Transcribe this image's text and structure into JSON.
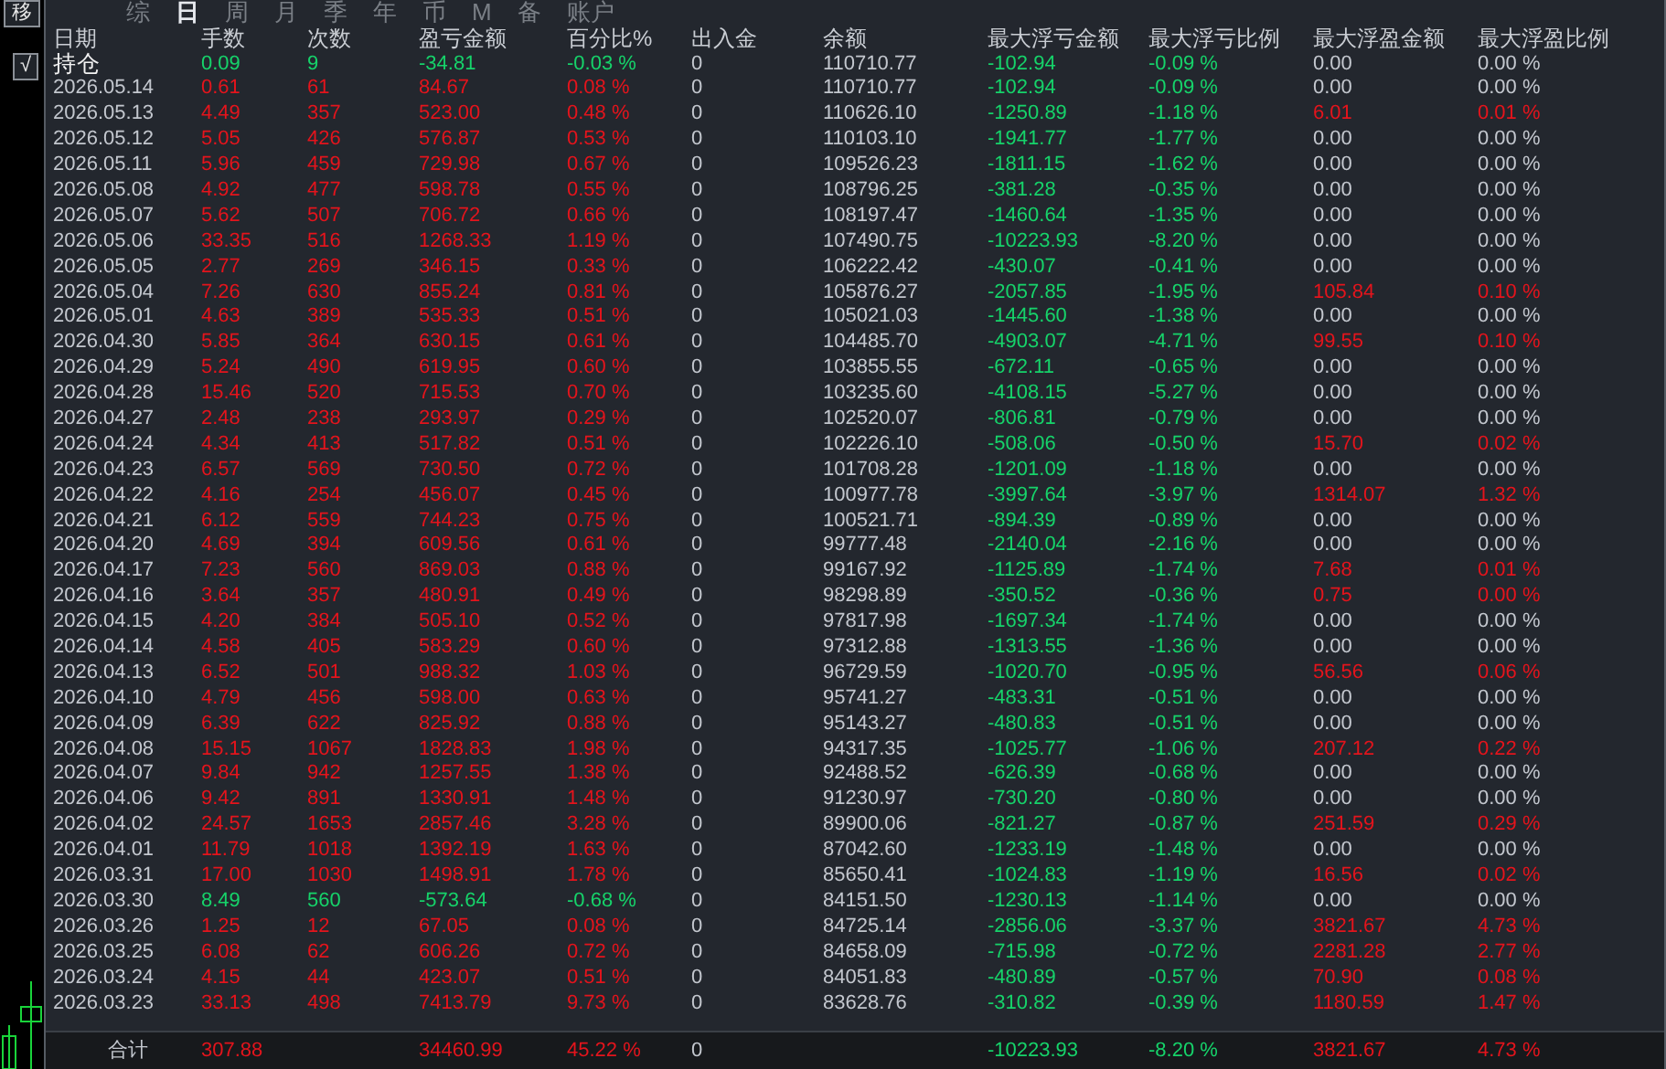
{
  "side_buttons": [
    "移",
    "√"
  ],
  "tabs": [
    {
      "label": "综",
      "selected": false
    },
    {
      "label": "日",
      "selected": true
    },
    {
      "label": "周",
      "selected": false
    },
    {
      "label": "月",
      "selected": false
    },
    {
      "label": "季",
      "selected": false
    },
    {
      "label": "年",
      "selected": false
    },
    {
      "label": "币",
      "selected": false
    },
    {
      "label": "M",
      "selected": false
    },
    {
      "label": "备",
      "selected": false
    },
    {
      "label": "账户",
      "selected": false
    }
  ],
  "table": {
    "columns": [
      "日期",
      "手数",
      "次数",
      "盈亏金额",
      "百分比%",
      "出入金",
      "余额",
      "最大浮亏金额",
      "最大浮亏比例",
      "最大浮盈金额",
      "最大浮盈比例"
    ],
    "rows": [
      {
        "kind": "position",
        "loss": true,
        "peak_gain": false,
        "cells": [
          "持仓",
          "0.09",
          "9",
          "-34.81",
          "-0.03 %",
          "0",
          "110710.77",
          "-102.94",
          "-0.09 %",
          "0.00",
          "0.00 %"
        ]
      },
      {
        "kind": "day",
        "loss": false,
        "peak_gain": false,
        "cells": [
          "2026.05.14",
          "0.61",
          "61",
          "84.67",
          "0.08 %",
          "0",
          "110710.77",
          "-102.94",
          "-0.09 %",
          "0.00",
          "0.00 %"
        ]
      },
      {
        "kind": "day",
        "loss": false,
        "peak_gain": true,
        "cells": [
          "2026.05.13",
          "4.49",
          "357",
          "523.00",
          "0.48 %",
          "0",
          "110626.10",
          "-1250.89",
          "-1.18 %",
          "6.01",
          "0.01 %"
        ]
      },
      {
        "kind": "day",
        "loss": false,
        "peak_gain": false,
        "cells": [
          "2026.05.12",
          "5.05",
          "426",
          "576.87",
          "0.53 %",
          "0",
          "110103.10",
          "-1941.77",
          "-1.77 %",
          "0.00",
          "0.00 %"
        ]
      },
      {
        "kind": "day",
        "loss": false,
        "peak_gain": false,
        "cells": [
          "2026.05.11",
          "5.96",
          "459",
          "729.98",
          "0.67 %",
          "0",
          "109526.23",
          "-1811.15",
          "-1.62 %",
          "0.00",
          "0.00 %"
        ]
      },
      {
        "kind": "day",
        "loss": false,
        "peak_gain": false,
        "cells": [
          "2026.05.08",
          "4.92",
          "477",
          "598.78",
          "0.55 %",
          "0",
          "108796.25",
          "-381.28",
          "-0.35 %",
          "0.00",
          "0.00 %"
        ]
      },
      {
        "kind": "day",
        "loss": false,
        "peak_gain": false,
        "cells": [
          "2026.05.07",
          "5.62",
          "507",
          "706.72",
          "0.66 %",
          "0",
          "108197.47",
          "-1460.64",
          "-1.35 %",
          "0.00",
          "0.00 %"
        ]
      },
      {
        "kind": "day",
        "loss": false,
        "peak_gain": false,
        "cells": [
          "2026.05.06",
          "33.35",
          "516",
          "1268.33",
          "1.19 %",
          "0",
          "107490.75",
          "-10223.93",
          "-8.20 %",
          "0.00",
          "0.00 %"
        ]
      },
      {
        "kind": "day",
        "loss": false,
        "peak_gain": false,
        "cells": [
          "2026.05.05",
          "2.77",
          "269",
          "346.15",
          "0.33 %",
          "0",
          "106222.42",
          "-430.07",
          "-0.41 %",
          "0.00",
          "0.00 %"
        ]
      },
      {
        "kind": "day",
        "loss": false,
        "peak_gain": true,
        "cells": [
          "2026.05.04",
          "7.26",
          "630",
          "855.24",
          "0.81 %",
          "0",
          "105876.27",
          "-2057.85",
          "-1.95 %",
          "105.84",
          "0.10 %"
        ]
      },
      {
        "kind": "day",
        "loss": false,
        "peak_gain": false,
        "cells": [
          "2026.05.01",
          "4.63",
          "389",
          "535.33",
          "0.51 %",
          "0",
          "105021.03",
          "-1445.60",
          "-1.38 %",
          "0.00",
          "0.00 %"
        ]
      },
      {
        "kind": "day",
        "loss": false,
        "peak_gain": true,
        "cells": [
          "2026.04.30",
          "5.85",
          "364",
          "630.15",
          "0.61 %",
          "0",
          "104485.70",
          "-4903.07",
          "-4.71 %",
          "99.55",
          "0.10 %"
        ]
      },
      {
        "kind": "day",
        "loss": false,
        "peak_gain": false,
        "cells": [
          "2026.04.29",
          "5.24",
          "490",
          "619.95",
          "0.60 %",
          "0",
          "103855.55",
          "-672.11",
          "-0.65 %",
          "0.00",
          "0.00 %"
        ]
      },
      {
        "kind": "day",
        "loss": false,
        "peak_gain": false,
        "cells": [
          "2026.04.28",
          "15.46",
          "520",
          "715.53",
          "0.70 %",
          "0",
          "103235.60",
          "-4108.15",
          "-5.27 %",
          "0.00",
          "0.00 %"
        ]
      },
      {
        "kind": "day",
        "loss": false,
        "peak_gain": false,
        "cells": [
          "2026.04.27",
          "2.48",
          "238",
          "293.97",
          "0.29 %",
          "0",
          "102520.07",
          "-806.81",
          "-0.79 %",
          "0.00",
          "0.00 %"
        ]
      },
      {
        "kind": "day",
        "loss": false,
        "peak_gain": true,
        "cells": [
          "2026.04.24",
          "4.34",
          "413",
          "517.82",
          "0.51 %",
          "0",
          "102226.10",
          "-508.06",
          "-0.50 %",
          "15.70",
          "0.02 %"
        ]
      },
      {
        "kind": "day",
        "loss": false,
        "peak_gain": false,
        "cells": [
          "2026.04.23",
          "6.57",
          "569",
          "730.50",
          "0.72 %",
          "0",
          "101708.28",
          "-1201.09",
          "-1.18 %",
          "0.00",
          "0.00 %"
        ]
      },
      {
        "kind": "day",
        "loss": false,
        "peak_gain": true,
        "cells": [
          "2026.04.22",
          "4.16",
          "254",
          "456.07",
          "0.45 %",
          "0",
          "100977.78",
          "-3997.64",
          "-3.97 %",
          "1314.07",
          "1.32 %"
        ]
      },
      {
        "kind": "day",
        "loss": false,
        "peak_gain": false,
        "cells": [
          "2026.04.21",
          "6.12",
          "559",
          "744.23",
          "0.75 %",
          "0",
          "100521.71",
          "-894.39",
          "-0.89 %",
          "0.00",
          "0.00 %"
        ]
      },
      {
        "kind": "day",
        "loss": false,
        "peak_gain": false,
        "cells": [
          "2026.04.20",
          "4.69",
          "394",
          "609.56",
          "0.61 %",
          "0",
          "99777.48",
          "-2140.04",
          "-2.16 %",
          "0.00",
          "0.00 %"
        ]
      },
      {
        "kind": "day",
        "loss": false,
        "peak_gain": true,
        "cells": [
          "2026.04.17",
          "7.23",
          "560",
          "869.03",
          "0.88 %",
          "0",
          "99167.92",
          "-1125.89",
          "-1.74 %",
          "7.68",
          "0.01 %"
        ]
      },
      {
        "kind": "day",
        "loss": false,
        "peak_gain": true,
        "cells": [
          "2026.04.16",
          "3.64",
          "357",
          "480.91",
          "0.49 %",
          "0",
          "98298.89",
          "-350.52",
          "-0.36 %",
          "0.75",
          "0.00 %"
        ]
      },
      {
        "kind": "day",
        "loss": false,
        "peak_gain": false,
        "cells": [
          "2026.04.15",
          "4.20",
          "384",
          "505.10",
          "0.52 %",
          "0",
          "97817.98",
          "-1697.34",
          "-1.74 %",
          "0.00",
          "0.00 %"
        ]
      },
      {
        "kind": "day",
        "loss": false,
        "peak_gain": false,
        "cells": [
          "2026.04.14",
          "4.58",
          "405",
          "583.29",
          "0.60 %",
          "0",
          "97312.88",
          "-1313.55",
          "-1.36 %",
          "0.00",
          "0.00 %"
        ]
      },
      {
        "kind": "day",
        "loss": false,
        "peak_gain": true,
        "cells": [
          "2026.04.13",
          "6.52",
          "501",
          "988.32",
          "1.03 %",
          "0",
          "96729.59",
          "-1020.70",
          "-0.95 %",
          "56.56",
          "0.06 %"
        ]
      },
      {
        "kind": "day",
        "loss": false,
        "peak_gain": false,
        "cells": [
          "2026.04.10",
          "4.79",
          "456",
          "598.00",
          "0.63 %",
          "0",
          "95741.27",
          "-483.31",
          "-0.51 %",
          "0.00",
          "0.00 %"
        ]
      },
      {
        "kind": "day",
        "loss": false,
        "peak_gain": false,
        "cells": [
          "2026.04.09",
          "6.39",
          "622",
          "825.92",
          "0.88 %",
          "0",
          "95143.27",
          "-480.83",
          "-0.51 %",
          "0.00",
          "0.00 %"
        ]
      },
      {
        "kind": "day",
        "loss": false,
        "peak_gain": true,
        "cells": [
          "2026.04.08",
          "15.15",
          "1067",
          "1828.83",
          "1.98 %",
          "0",
          "94317.35",
          "-1025.77",
          "-1.06 %",
          "207.12",
          "0.22 %"
        ]
      },
      {
        "kind": "day",
        "loss": false,
        "peak_gain": false,
        "cells": [
          "2026.04.07",
          "9.84",
          "942",
          "1257.55",
          "1.38 %",
          "0",
          "92488.52",
          "-626.39",
          "-0.68 %",
          "0.00",
          "0.00 %"
        ]
      },
      {
        "kind": "day",
        "loss": false,
        "peak_gain": false,
        "cells": [
          "2026.04.06",
          "9.42",
          "891",
          "1330.91",
          "1.48 %",
          "0",
          "91230.97",
          "-730.20",
          "-0.80 %",
          "0.00",
          "0.00 %"
        ]
      },
      {
        "kind": "day",
        "loss": false,
        "peak_gain": true,
        "cells": [
          "2026.04.02",
          "24.57",
          "1653",
          "2857.46",
          "3.28 %",
          "0",
          "89900.06",
          "-821.27",
          "-0.87 %",
          "251.59",
          "0.29 %"
        ]
      },
      {
        "kind": "day",
        "loss": false,
        "peak_gain": false,
        "cells": [
          "2026.04.01",
          "11.79",
          "1018",
          "1392.19",
          "1.63 %",
          "0",
          "87042.60",
          "-1233.19",
          "-1.48 %",
          "0.00",
          "0.00 %"
        ]
      },
      {
        "kind": "day",
        "loss": false,
        "peak_gain": true,
        "cells": [
          "2026.03.31",
          "17.00",
          "1030",
          "1498.91",
          "1.78 %",
          "0",
          "85650.41",
          "-1024.83",
          "-1.19 %",
          "16.56",
          "0.02 %"
        ]
      },
      {
        "kind": "day",
        "loss": true,
        "peak_gain": false,
        "cells": [
          "2026.03.30",
          "8.49",
          "560",
          "-573.64",
          "-0.68 %",
          "0",
          "84151.50",
          "-1230.13",
          "-1.14 %",
          "0.00",
          "0.00 %"
        ]
      },
      {
        "kind": "day",
        "loss": false,
        "peak_gain": true,
        "cells": [
          "2026.03.26",
          "1.25",
          "12",
          "67.05",
          "0.08 %",
          "0",
          "84725.14",
          "-2856.06",
          "-3.37 %",
          "3821.67",
          "4.73 %"
        ]
      },
      {
        "kind": "day",
        "loss": false,
        "peak_gain": true,
        "cells": [
          "2026.03.25",
          "6.08",
          "62",
          "606.26",
          "0.72 %",
          "0",
          "84658.09",
          "-715.98",
          "-0.72 %",
          "2281.28",
          "2.77 %"
        ]
      },
      {
        "kind": "day",
        "loss": false,
        "peak_gain": true,
        "cells": [
          "2026.03.24",
          "4.15",
          "44",
          "423.07",
          "0.51 %",
          "0",
          "84051.83",
          "-480.89",
          "-0.57 %",
          "70.90",
          "0.08 %"
        ]
      },
      {
        "kind": "day",
        "loss": false,
        "peak_gain": true,
        "cells": [
          "2026.03.23",
          "33.13",
          "498",
          "7413.79",
          "9.73 %",
          "0",
          "83628.76",
          "-310.82",
          "-0.39 %",
          "1180.59",
          "1.47 %"
        ]
      }
    ],
    "total": {
      "loss": false,
      "peak_gain": true,
      "cells": [
        "合计",
        "307.88",
        "",
        "34460.99",
        "45.22 %",
        "0",
        "",
        "-10223.93",
        "-8.20 %",
        "3821.67",
        "4.73 %"
      ]
    }
  }
}
